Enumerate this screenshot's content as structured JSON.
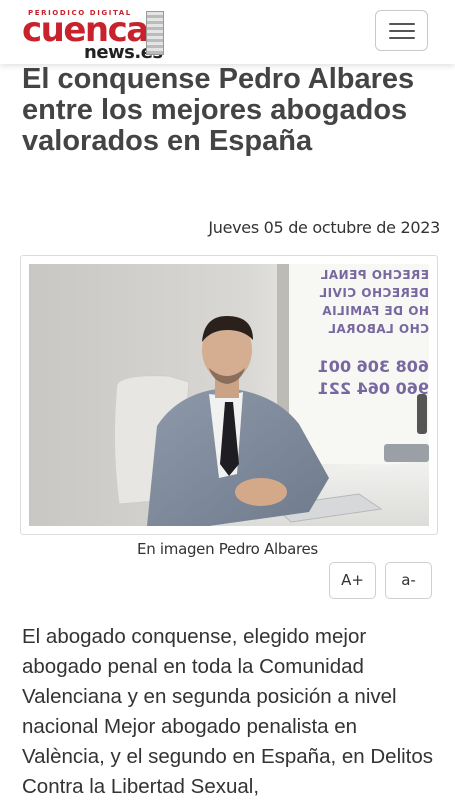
{
  "header": {
    "logo": {
      "top_text": "PERIODICO DIGITAL",
      "main_text": "cuenca",
      "sub_text": "news.es"
    },
    "menu_icon": "hamburger-menu-icon"
  },
  "article": {
    "title": "El conquense Pedro Albares entre los mejores abogados valorados en España",
    "date": "Jueves 05 de octubre de 2023",
    "image": {
      "sign_lines": [
        "ERECHO PENAL",
        "DERECHO CIVIL",
        "HO DE FAMILIA",
        "CHO LABORAL"
      ],
      "phone_lines": [
        "608 306 001",
        "960 064 221"
      ]
    },
    "caption": "En imagen Pedro Albares",
    "font_increase_label": "A+",
    "font_decrease_label": "a-",
    "body": "El abogado conquense, elegido mejor abogado penal en toda la Comunidad Valenciana y en segunda posición a nivel nacional Mejor abogado penalista en València, y el segundo en España, en Delitos Contra la Libertad Sexual,"
  },
  "colors": {
    "brand_red": "#c8232c",
    "title_gray": "#444444"
  }
}
